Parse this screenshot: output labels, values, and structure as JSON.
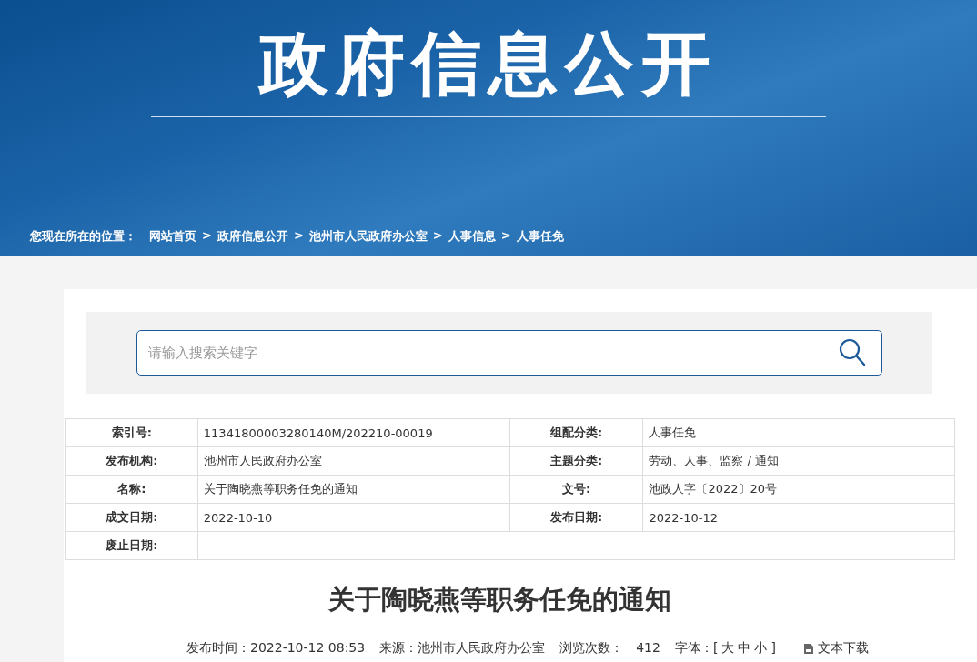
{
  "header": {
    "title": "政府信息公开"
  },
  "breadcrumb": {
    "label": "您现在所在的位置：",
    "separator": ">",
    "items": [
      "网站首页",
      "政府信息公开",
      "池州市人民政府办公室",
      "人事信息",
      "人事任免"
    ]
  },
  "search": {
    "placeholder": "请输入搜索关键字"
  },
  "info_table": {
    "rows": [
      [
        {
          "label": "索引号:",
          "value": "11341800003280140M/202210-00019"
        },
        {
          "label": "组配分类:",
          "value": "人事任免"
        }
      ],
      [
        {
          "label": "发布机构:",
          "value": "池州市人民政府办公室"
        },
        {
          "label": "主题分类:",
          "value": "劳动、人事、监察 / 通知"
        }
      ],
      [
        {
          "label": "名称:",
          "value": "关于陶晓燕等职务任免的通知"
        },
        {
          "label": "文号:",
          "value": "池政人字〔2022〕20号"
        }
      ],
      [
        {
          "label": "成文日期:",
          "value": "2022-10-10"
        },
        {
          "label": "发布日期:",
          "value": "2022-10-12"
        }
      ],
      [
        {
          "label": "废止日期:"
        }
      ]
    ]
  },
  "article": {
    "title": "关于陶晓燕等职务任免的通知",
    "meta": {
      "published": "发布时间：2022-10-12 08:53",
      "source": "来源：池州市人民政府办公室",
      "views_label": "浏览次数：",
      "views": "412",
      "font_label": "字体：[",
      "font_sizes": [
        "大",
        "中",
        "小"
      ],
      "font_end": "]",
      "download": "文本下载"
    }
  }
}
